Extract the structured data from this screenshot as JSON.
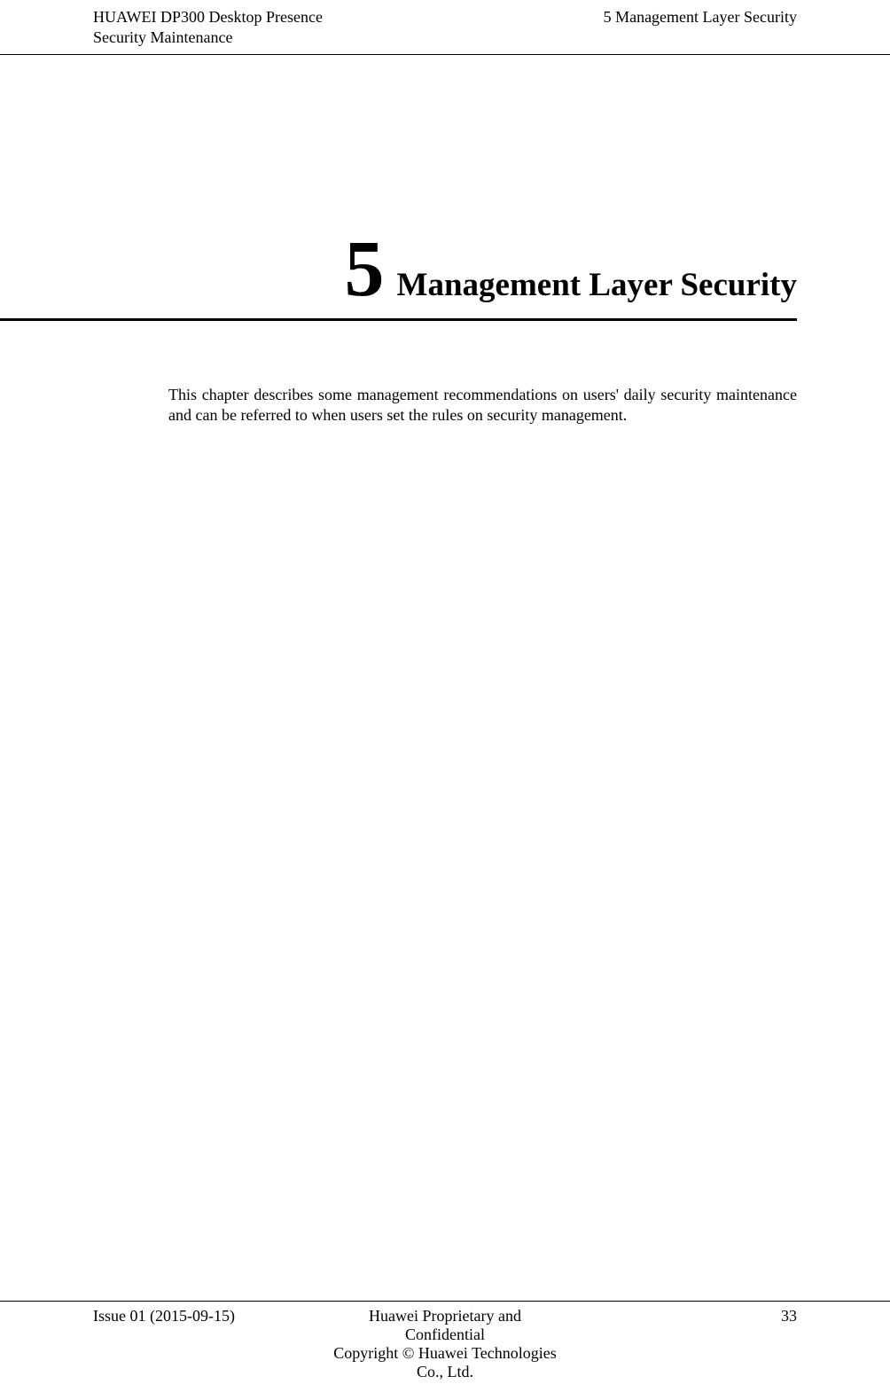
{
  "header": {
    "left_line1": "HUAWEI DP300 Desktop Presence",
    "left_line2": "Security Maintenance",
    "right": "5 Management Layer Security"
  },
  "chapter": {
    "number": "5",
    "title": "Management Layer Security",
    "intro": "This chapter describes some management recommendations on users' daily security maintenance and can be referred to when users set the rules on security management."
  },
  "footer": {
    "left": "Issue 01 (2015-09-15)",
    "center_line1": "Huawei Proprietary and Confidential",
    "center_line2": "Copyright © Huawei Technologies Co., Ltd.",
    "right": "33"
  }
}
